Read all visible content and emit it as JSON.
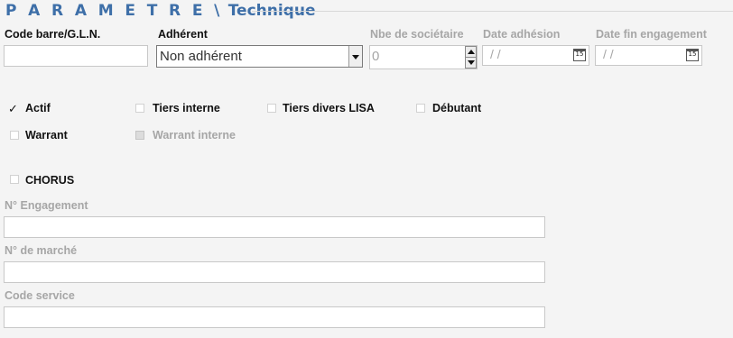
{
  "section": {
    "title_prefix": "P A R A M E T R E \\",
    "title_suffix": "Technique"
  },
  "fields": {
    "code_barre": {
      "label": "Code barre/G.L.N.",
      "value": ""
    },
    "adherent": {
      "label": "Adhérent",
      "value": "Non adhérent"
    },
    "nbe_societaire": {
      "label": "Nbe de sociétaire",
      "value": "0"
    },
    "date_adhesion": {
      "label": "Date adhésion",
      "value": "/ /"
    },
    "date_fin_engagement": {
      "label": "Date fin engagement",
      "value": "/ /"
    }
  },
  "calendar_icon_text": "15",
  "checkboxes": {
    "actif": {
      "label": "Actif",
      "checked": true
    },
    "tiers_interne": {
      "label": "Tiers interne",
      "checked": false
    },
    "tiers_divers_lisa": {
      "label": "Tiers divers LISA",
      "checked": false
    },
    "debutant": {
      "label": "Débutant",
      "checked": false
    },
    "warrant": {
      "label": "Warrant",
      "checked": false
    },
    "warrant_interne": {
      "label": "Warrant interne",
      "checked": false,
      "disabled": true
    },
    "chorus": {
      "label": "CHORUS",
      "checked": false
    }
  },
  "check_mark": "✓",
  "chorus_fields": {
    "engagement": {
      "label": "N° Engagement",
      "value": ""
    },
    "marche": {
      "label": "N° de marché",
      "value": ""
    },
    "code_service": {
      "label": "Code service",
      "value": ""
    }
  },
  "colors": {
    "title": "#3e6fa8",
    "background": "#f4f4f4",
    "disabled_text": "#a6a6a6"
  }
}
